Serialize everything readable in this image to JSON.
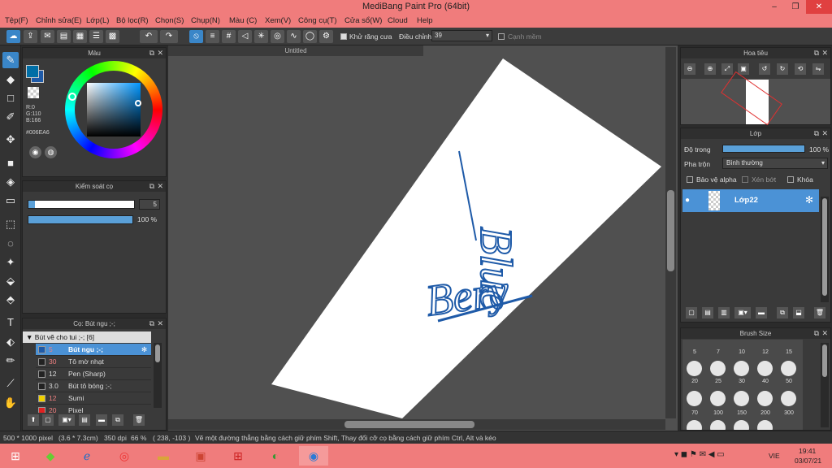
{
  "window": {
    "title": "MediBang Paint Pro (64bit)",
    "minimize": "–",
    "maximize": "❐",
    "close": "✕"
  },
  "menu": [
    "Tệp(F)",
    "Chỉnh sửa(E)",
    "Lớp(L)",
    "Bộ lọc(R)",
    "Chọn(S)",
    "Chụp(N)",
    "Màu (C)",
    "Xem(V)",
    "Công cụ(T)",
    "Cửa sổ(W)",
    "Cloud",
    "Help"
  ],
  "toolbar": {
    "antialias_label": "Khử răng cưa",
    "antialias_checked": true,
    "adjust_label": "Điều chỉnh",
    "adjust_value": "39",
    "soft_edge_label": "Cạnh mềm"
  },
  "color_panel": {
    "title": "Màu",
    "r": "R:0",
    "g": "G:110",
    "b": "B:166",
    "hex": "#006EA6",
    "fg_color": "#006ea6",
    "bg_color": "#1e5aa8"
  },
  "brush_control": {
    "title": "Kiểm soát cọ",
    "size": "5",
    "opacity": "100 %",
    "size_fill": 0.03,
    "opacity_fill": 1.0
  },
  "brush_panel": {
    "title": "Cọ: Bút ngu ;-;",
    "group": "Bút vẽ cho tui ;-; [6]",
    "items": [
      {
        "size": "5",
        "name": "Bút ngu ;-;",
        "color": "#1e5aa8",
        "selected": true
      },
      {
        "size": "30",
        "name": "Tô mờ nhạt",
        "color": "#222222",
        "selected": false
      },
      {
        "size": "12",
        "name": "Pen (Sharp)",
        "color": "#222222",
        "selected": false
      },
      {
        "size": "3.0",
        "name": "Bút tô bóng ;-;",
        "color": "#222222",
        "selected": false
      },
      {
        "size": "12",
        "name": "Sumi",
        "color": "#f0d000",
        "selected": false
      },
      {
        "size": "20",
        "name": "Pixel",
        "color": "#e02020",
        "selected": false
      }
    ]
  },
  "canvas": {
    "tab": "Untitled",
    "text1": "Blue",
    "text2": "Bery",
    "ink": "#1e5aa8"
  },
  "navigator": {
    "title": "Hoa tiêu"
  },
  "layer_panel": {
    "title": "Lớp",
    "opacity_label": "Độ trong",
    "opacity_value": "100 %",
    "blend_label": "Pha trộn",
    "blend_value": "Bình thường",
    "protect_alpha": "Bảo vệ alpha",
    "clip": "Xén bớt",
    "lock": "Khóa",
    "layer_name": "Lớp22"
  },
  "brush_size_panel": {
    "title": "Brush Size",
    "row1": [
      "5",
      "7",
      "10",
      "12",
      "15"
    ],
    "row2": [
      "20",
      "25",
      "30",
      "40",
      "50"
    ],
    "row3": [
      "70",
      "100",
      "150",
      "200",
      "300"
    ]
  },
  "status": {
    "size": "500 * 1000 pixel",
    "cm": "(3.6 * 7.3cm)",
    "dpi": "350 dpi",
    "zoom": "66 %",
    "coords": "( 238, -103 )",
    "hint": "Vẽ một đường thẳng bằng cách giữ phím Shift, Thay đổi cỡ cọ bằng cách giữ phím Ctrl, Alt và kéo"
  },
  "taskbar": {
    "lang": "VIE",
    "time": "19:41",
    "date": "03/07/21"
  }
}
